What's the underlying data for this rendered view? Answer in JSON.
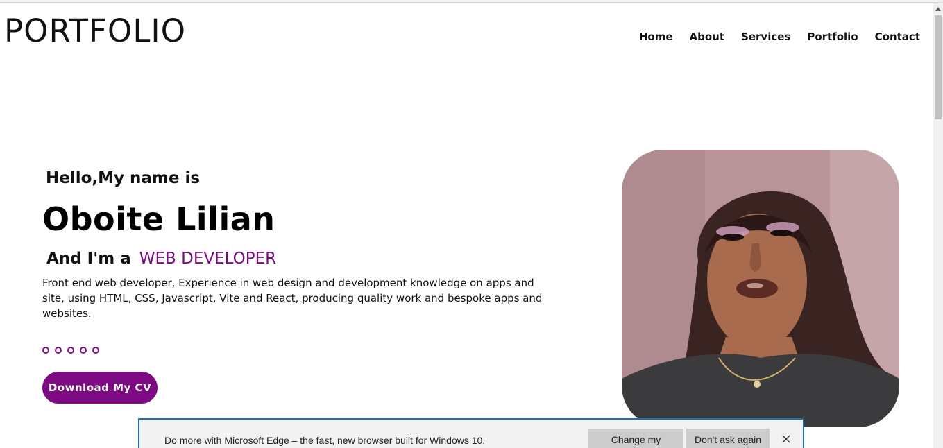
{
  "header": {
    "logo": "PORTFOLIO",
    "nav": [
      "Home",
      "About",
      "Services",
      "Portfolio",
      "Contact"
    ]
  },
  "hero": {
    "greeting": "Hello,My name is",
    "name": "Oboite Lilian",
    "role_prefix": "And I'm a",
    "role_highlight": "WEB DEVELOPER",
    "description": "Front end web developer, Experience in web design and development knowledge on apps and site, using HTML, CSS, Javascript, Vite and React, producing quality work and bespoke apps and websites.",
    "dot_count": 5,
    "cv_button": "Download My CV"
  },
  "edge_prompt": {
    "message": "Do more with Microsoft Edge – the fast, new browser built for Windows 10.",
    "change_default": "Change my default",
    "dont_ask": "Don't ask again",
    "close_icon": "close-icon"
  },
  "colors": {
    "accent": "#7d0a82",
    "text": "#111111",
    "edge_border": "#1f6fb5"
  }
}
